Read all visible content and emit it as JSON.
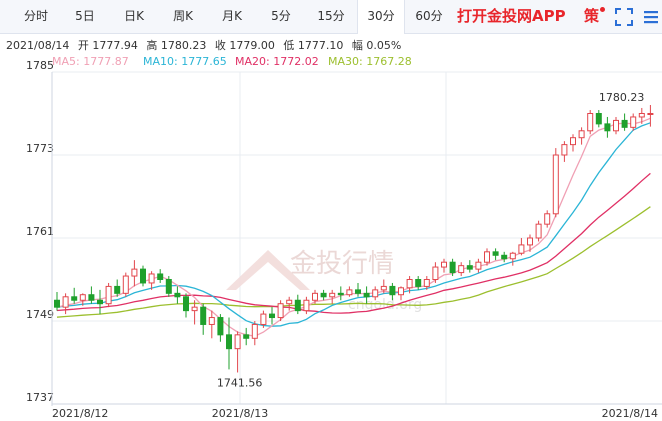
{
  "tabs": [
    {
      "label": "分时",
      "active": false
    },
    {
      "label": "5日",
      "active": false
    },
    {
      "label": "日K",
      "active": false
    },
    {
      "label": "周K",
      "active": false
    },
    {
      "label": "月K",
      "active": false
    },
    {
      "label": "5分",
      "active": false
    },
    {
      "label": "15分",
      "active": false
    },
    {
      "label": "30分",
      "active": true
    },
    {
      "label": "60分",
      "active": false
    }
  ],
  "app_link": "打开金投网APP",
  "strategy_label": "策",
  "icons": {
    "fullscreen": "fullscreen-icon",
    "menu": "menu-icon",
    "notification": "red-dot"
  },
  "info": {
    "date": "2021/08/14",
    "open": "开 1777.94",
    "high": "高 1780.23",
    "close": "收 1779.00",
    "low": "低 1777.10",
    "amplitude": "幅 0.05%"
  },
  "ma": {
    "ma5": "MA5: 1777.87",
    "ma10": "MA10: 1777.65",
    "ma20": "MA20: 1772.02",
    "ma30": "MA30: 1767.28"
  },
  "watermark": {
    "text": "金投行情",
    "url": "cngold.org"
  },
  "colors": {
    "up": "#e2464c",
    "down": "#1fa02c",
    "ma5": "#f0a0b4",
    "ma10": "#2bb5d6",
    "ma20": "#e03065",
    "ma30": "#9cbf2e",
    "grid": "#e8ecf2",
    "accent": "#e8262b"
  },
  "chart_data": {
    "type": "candlestick",
    "y_ticks": [
      "1785",
      "1773",
      "1761",
      "1749",
      "1737"
    ],
    "ylim": [
      1737,
      1785
    ],
    "x_labels": [
      "2021/8/12",
      "2021/8/13",
      "2021/8/14"
    ],
    "annotations": {
      "max": "1780.23",
      "min": "1741.56"
    },
    "candles": [
      [
        1752.0,
        1753.2,
        1750.5,
        1751.0
      ],
      [
        1751.0,
        1753.0,
        1750.0,
        1752.5
      ],
      [
        1752.5,
        1753.8,
        1751.5,
        1752.0
      ],
      [
        1752.0,
        1753.0,
        1751.2,
        1752.8
      ],
      [
        1752.8,
        1754.0,
        1751.5,
        1752.0
      ],
      [
        1752.0,
        1753.5,
        1750.0,
        1751.5
      ],
      [
        1751.5,
        1754.5,
        1751.0,
        1754.0
      ],
      [
        1754.0,
        1755.0,
        1752.5,
        1753.0
      ],
      [
        1753.0,
        1756.0,
        1752.5,
        1755.5
      ],
      [
        1755.5,
        1757.8,
        1754.0,
        1756.5
      ],
      [
        1756.5,
        1757.0,
        1754.0,
        1754.5
      ],
      [
        1754.5,
        1756.2,
        1753.5,
        1755.8
      ],
      [
        1755.8,
        1756.5,
        1754.5,
        1755.0
      ],
      [
        1755.0,
        1755.5,
        1752.5,
        1753.0
      ],
      [
        1753.0,
        1754.0,
        1751.5,
        1752.5
      ],
      [
        1752.5,
        1753.0,
        1749.5,
        1750.5
      ],
      [
        1750.5,
        1752.0,
        1748.5,
        1751.0
      ],
      [
        1751.0,
        1751.5,
        1747.0,
        1748.5
      ],
      [
        1748.5,
        1750.5,
        1746.5,
        1749.5
      ],
      [
        1749.5,
        1750.0,
        1746.0,
        1747.0
      ],
      [
        1747.0,
        1749.5,
        1742.0,
        1745.0
      ],
      [
        1745.0,
        1747.5,
        1741.56,
        1747.0
      ],
      [
        1747.0,
        1748.0,
        1745.5,
        1746.5
      ],
      [
        1746.5,
        1749.0,
        1745.5,
        1748.5
      ],
      [
        1748.5,
        1750.5,
        1748.0,
        1750.0
      ],
      [
        1750.0,
        1751.0,
        1748.5,
        1749.5
      ],
      [
        1749.5,
        1752.0,
        1749.0,
        1751.5
      ],
      [
        1751.5,
        1752.5,
        1750.5,
        1752.0
      ],
      [
        1752.0,
        1752.8,
        1750.0,
        1750.5
      ],
      [
        1750.5,
        1752.5,
        1750.0,
        1752.0
      ],
      [
        1752.0,
        1753.5,
        1751.5,
        1753.0
      ],
      [
        1753.0,
        1753.5,
        1752.0,
        1752.5
      ],
      [
        1752.5,
        1753.5,
        1751.5,
        1753.0
      ],
      [
        1753.0,
        1754.0,
        1752.0,
        1752.8
      ],
      [
        1752.8,
        1754.0,
        1752.5,
        1753.5
      ],
      [
        1753.5,
        1754.5,
        1752.5,
        1753.0
      ],
      [
        1753.0,
        1754.0,
        1751.5,
        1752.5
      ],
      [
        1752.5,
        1754.0,
        1752.0,
        1753.5
      ],
      [
        1753.5,
        1755.0,
        1753.0,
        1754.0
      ],
      [
        1754.0,
        1754.5,
        1752.0,
        1752.8
      ],
      [
        1752.8,
        1754.0,
        1752.0,
        1753.8
      ],
      [
        1753.8,
        1755.5,
        1753.0,
        1755.0
      ],
      [
        1755.0,
        1755.5,
        1753.5,
        1754.0
      ],
      [
        1754.0,
        1755.5,
        1753.5,
        1755.0
      ],
      [
        1755.0,
        1757.5,
        1754.5,
        1756.8
      ],
      [
        1756.8,
        1758.0,
        1756.0,
        1757.5
      ],
      [
        1757.5,
        1758.0,
        1755.5,
        1756.0
      ],
      [
        1756.0,
        1757.5,
        1755.5,
        1757.0
      ],
      [
        1757.0,
        1757.8,
        1756.0,
        1756.5
      ],
      [
        1756.5,
        1758.0,
        1756.0,
        1757.5
      ],
      [
        1757.5,
        1759.5,
        1757.0,
        1759.0
      ],
      [
        1759.0,
        1759.5,
        1757.8,
        1758.5
      ],
      [
        1758.5,
        1759.0,
        1757.5,
        1758.0
      ],
      [
        1758.0,
        1759.0,
        1757.0,
        1758.8
      ],
      [
        1758.8,
        1761.0,
        1758.5,
        1760.0
      ],
      [
        1760.0,
        1761.5,
        1759.0,
        1761.0
      ],
      [
        1761.0,
        1763.5,
        1760.5,
        1763.0
      ],
      [
        1763.0,
        1765.0,
        1762.5,
        1764.5
      ],
      [
        1764.5,
        1774.0,
        1764.0,
        1773.0
      ],
      [
        1773.0,
        1775.0,
        1772.0,
        1774.5
      ],
      [
        1774.5,
        1776.0,
        1773.5,
        1775.5
      ],
      [
        1775.5,
        1777.0,
        1774.5,
        1776.5
      ],
      [
        1776.5,
        1779.5,
        1776.0,
        1779.0
      ],
      [
        1779.0,
        1779.5,
        1777.0,
        1777.5
      ],
      [
        1777.5,
        1778.5,
        1775.5,
        1776.5
      ],
      [
        1776.5,
        1778.5,
        1776.0,
        1778.0
      ],
      [
        1778.0,
        1779.0,
        1776.5,
        1777.0
      ],
      [
        1777.0,
        1779.0,
        1776.5,
        1778.5
      ],
      [
        1778.5,
        1779.8,
        1777.5,
        1779.0
      ],
      [
        1779.0,
        1780.23,
        1777.1,
        1779.0
      ]
    ]
  }
}
